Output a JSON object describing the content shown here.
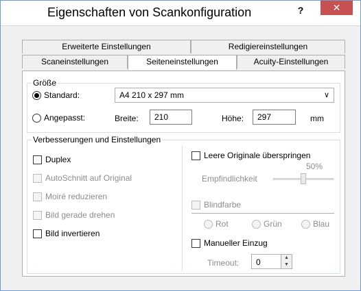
{
  "window": {
    "title": "Eigenschaften von Scankonfiguration",
    "help_label": "?",
    "close_label": "✕"
  },
  "tabs": {
    "row1": [
      "Erweiterte Einstellungen",
      "Redigiereinstellungen"
    ],
    "row2": [
      "Scaneinstellungen",
      "Seiteneinstellungen",
      "Acuity-Einstellungen"
    ],
    "active": "Seiteneinstellungen"
  },
  "size_group": {
    "label": "Größe",
    "standard_label": "Standard:",
    "standard_selected": true,
    "standard_value": "A4 210 x 297 mm",
    "custom_label": "Angepasst:",
    "width_label": "Breite:",
    "width_value": "210",
    "height_label": "Höhe:",
    "height_value": "297",
    "unit": "mm"
  },
  "enhance_group": {
    "label": "Verbesserungen und Einstellungen",
    "left": [
      {
        "label": "Duplex",
        "enabled": true,
        "checked": false
      },
      {
        "label": "AutoSchnitt auf Original",
        "enabled": false,
        "checked": false
      },
      {
        "label": "Moiré reduzieren",
        "enabled": false,
        "checked": false
      },
      {
        "label": "Bild gerade drehen",
        "enabled": false,
        "checked": false
      },
      {
        "label": "Bild invertieren",
        "enabled": true,
        "checked": false
      }
    ],
    "skip_blank_label": "Leere Originale überspringen",
    "sensitivity_label": "Empfindlichkeit",
    "sensitivity_value": "50%",
    "sensitivity_fraction": 0.5,
    "dropout_label": "Blindfarbe",
    "dropout_colors": [
      "Rot",
      "Grün",
      "Blau"
    ],
    "manual_feed_label": "Manueller Einzug",
    "timeout_label": "Timeout:",
    "timeout_value": "0"
  },
  "colors": {
    "close_bg": "#c75050",
    "window_border": "#6c9bd2",
    "disabled_text": "#8d8d8d"
  }
}
